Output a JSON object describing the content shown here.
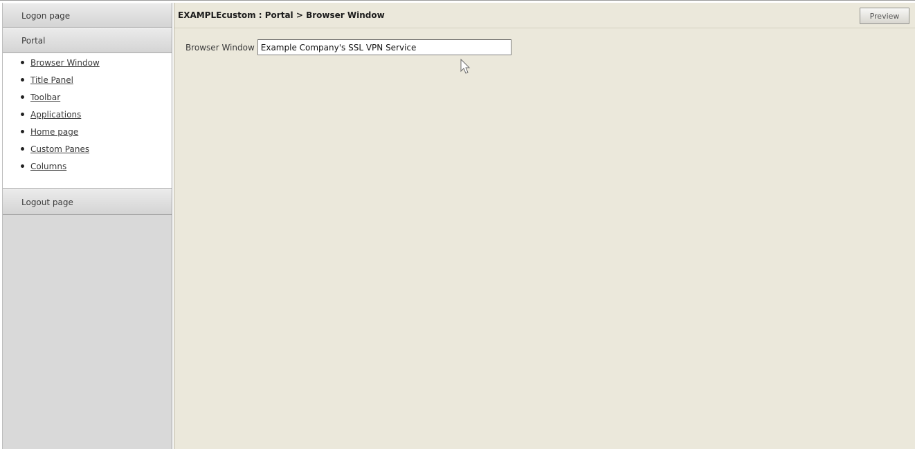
{
  "sidebar": {
    "sections": {
      "logon": "Logon page",
      "portal": "Portal",
      "logout": "Logout page"
    },
    "portal_items": [
      {
        "label": "Browser Window"
      },
      {
        "label": "Title Panel"
      },
      {
        "label": "Toolbar"
      },
      {
        "label": "Applications"
      },
      {
        "label": "Home page"
      },
      {
        "label": "Custom Panes"
      },
      {
        "label": "Columns"
      }
    ]
  },
  "main": {
    "breadcrumb": "EXAMPLEcustom : Portal > Browser Window",
    "preview_label": "Preview",
    "field": {
      "label": "Browser Window",
      "value": "Example Company's SSL VPN Service"
    }
  },
  "colors": {
    "content_bg": "#ebe8db",
    "sidebar_bg": "#d9d9d9"
  },
  "icons": {
    "cursor": "mouse-pointer-icon"
  }
}
